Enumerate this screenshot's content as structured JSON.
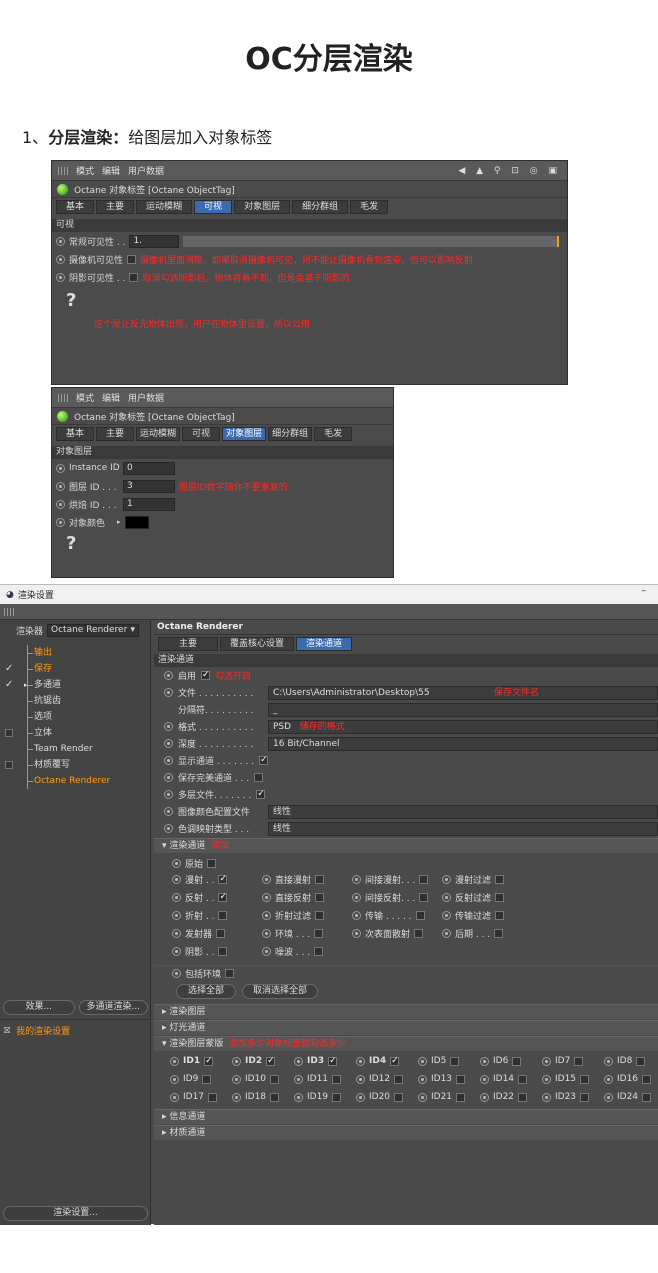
{
  "page": {
    "title": "OC分层渲染",
    "step_prefix": "1、",
    "step_bold": "分层渲染：",
    "step_text": "给图层加入对象标签"
  },
  "panel1": {
    "menu": [
      "模式",
      "编辑",
      "用户数据"
    ],
    "tag_title": "Octane 对象标签 [Octane ObjectTag]",
    "tabs": [
      "基本",
      "主要",
      "运动模糊",
      "可视",
      "对象图层",
      "细分群组",
      "毛发"
    ],
    "active_tab": "可视",
    "section": "可视",
    "rows": [
      {
        "label": "常规可见性 . .",
        "value": "1."
      },
      {
        "label": "摄像机可见性",
        "note": "摄像机里面消隐，如果取消摄像机可见，则不能让摄像机看到渲染，但可以影响反射"
      },
      {
        "label": "阴影可见性 . .",
        "note": "取消勾选阴影后，物体将看不到，但是会基于阴影的"
      }
    ],
    "help_note": "这个是让反光物体出现，用户在物体里设置，所以公用"
  },
  "panel2": {
    "menu": [
      "模式",
      "编辑",
      "用户数据"
    ],
    "tag_title": "Octane 对象标签 [Octane ObjectTag]",
    "tabs": [
      "基本",
      "主要",
      "运动模糊",
      "可视",
      "对象图层",
      "细分群组",
      "毛发"
    ],
    "active_tab": "对象图层",
    "section": "对象图层",
    "rows": [
      {
        "label": "Instance ID",
        "value": "0"
      },
      {
        "label": "图层 ID . . .",
        "value": "3",
        "note": "图层ID数字随你不要重复的"
      },
      {
        "label": "烘焙 ID . . .",
        "value": "1"
      },
      {
        "label": "对象颜色",
        "color": "#000000"
      }
    ]
  },
  "render": {
    "window_title": "渲染设置",
    "minimize": "–",
    "renderer_label": "渲染器",
    "renderer_value": "Octane Renderer",
    "tree": [
      {
        "label": "输出",
        "mark": "",
        "selected": true
      },
      {
        "label": "保存",
        "mark": "check",
        "selected": true
      },
      {
        "label": "多通道",
        "mark": "check",
        "selected": false,
        "expand": true
      },
      {
        "label": "抗锯齿",
        "mark": "",
        "selected": false
      },
      {
        "label": "选项",
        "mark": "",
        "selected": false
      },
      {
        "label": "立体",
        "mark": "box",
        "selected": false
      },
      {
        "label": "Team Render",
        "mark": "",
        "selected": false
      },
      {
        "label": "材质覆写",
        "mark": "box",
        "selected": false
      },
      {
        "label": "Octane Renderer",
        "mark": "",
        "selected": true
      }
    ],
    "left_buttons": {
      "effects": "效果...",
      "multipass": "多通道渲染..."
    },
    "my_settings": "我的渲染设置",
    "bottom_button": "渲染设置...",
    "header": "Octane Renderer",
    "tabs": [
      "主要",
      "覆盖核心设置",
      "渲染通道"
    ],
    "active_tab": "渲染通道",
    "section": "渲染通道",
    "enable_label": "启用",
    "enable_note": "勾选开启",
    "file_label": "文件 . . . . . . . . . .",
    "file_value": "C:\\Users\\Administrator\\Desktop\\55",
    "file_note": "保存文件名",
    "sep_label": "分隔符. . . . . . . . .",
    "sep_value": "_",
    "format_label": "格式 . . . . . . . . . .",
    "format_value": "PSD",
    "format_note": "储存的格式",
    "depth_label": "深度 . . . . . . . . . .",
    "depth_value": "16 Bit/Channel",
    "options": [
      {
        "label": "显示通道 . . . . . . .",
        "checked": true
      },
      {
        "label": "保存完美通道 . . .",
        "checked": false
      },
      {
        "label": "多层文件. . . . . . .",
        "checked": true
      }
    ],
    "profile_label": "图像颜色配置文件",
    "profile_value": "线性",
    "tonemap_label": "色调映射类型 . . .",
    "tonemap_value": "线性",
    "passes_group": "渲染通道",
    "passes_note": "添加",
    "passes": [
      {
        "label": "原始",
        "checked": false
      },
      {
        "label": "漫射 . .",
        "checked": true
      },
      {
        "label": "直接漫射",
        "checked": false
      },
      {
        "label": "间接漫射. . .",
        "checked": false
      },
      {
        "label": "漫射过滤",
        "checked": false
      },
      {
        "label": "反射 . .",
        "checked": true
      },
      {
        "label": "直接反射",
        "checked": false
      },
      {
        "label": "间接反射. . .",
        "checked": false
      },
      {
        "label": "反射过滤",
        "checked": false
      },
      {
        "label": "折射 . .",
        "checked": false
      },
      {
        "label": "折射过滤",
        "checked": false
      },
      {
        "label": "传输 . . . . .",
        "checked": false
      },
      {
        "label": "传输过滤",
        "checked": false
      },
      {
        "label": "发射器",
        "checked": false
      },
      {
        "label": "环境 . . .",
        "checked": false
      },
      {
        "label": "次表面散射",
        "checked": false
      },
      {
        "label": "后期 . . .",
        "checked": false
      },
      {
        "label": "阴影 . .",
        "checked": false
      },
      {
        "label": "噪波 . . .",
        "checked": false
      }
    ],
    "include_env": "包括环境",
    "select_all": "选择全部",
    "deselect_all": "取消选择全部",
    "groups": [
      "渲染图层",
      "灯光通道"
    ],
    "mask_group": "渲染图层蒙版",
    "mask_note": "添加多少对象标签就勾选多少",
    "ids": [
      {
        "label": "ID1",
        "checked": true
      },
      {
        "label": "ID2",
        "checked": true
      },
      {
        "label": "ID3",
        "checked": true
      },
      {
        "label": "ID4",
        "checked": true
      },
      {
        "label": "ID5",
        "checked": false
      },
      {
        "label": "ID6",
        "checked": false
      },
      {
        "label": "ID7",
        "checked": false
      },
      {
        "label": "ID8",
        "checked": false
      },
      {
        "label": "ID9",
        "checked": false
      },
      {
        "label": "ID10",
        "checked": false
      },
      {
        "label": "ID11",
        "checked": false
      },
      {
        "label": "ID12",
        "checked": false
      },
      {
        "label": "ID13",
        "checked": false
      },
      {
        "label": "ID14",
        "checked": false
      },
      {
        "label": "ID15",
        "checked": false
      },
      {
        "label": "ID16",
        "checked": false
      },
      {
        "label": "ID17",
        "checked": false
      },
      {
        "label": "ID18",
        "checked": false
      },
      {
        "label": "ID19",
        "checked": false
      },
      {
        "label": "ID20",
        "checked": false
      },
      {
        "label": "ID21",
        "checked": false
      },
      {
        "label": "ID22",
        "checked": false
      },
      {
        "label": "ID23",
        "checked": false
      },
      {
        "label": "ID24",
        "checked": false
      }
    ],
    "tail_groups": [
      "信息通道",
      "材质通道"
    ]
  }
}
